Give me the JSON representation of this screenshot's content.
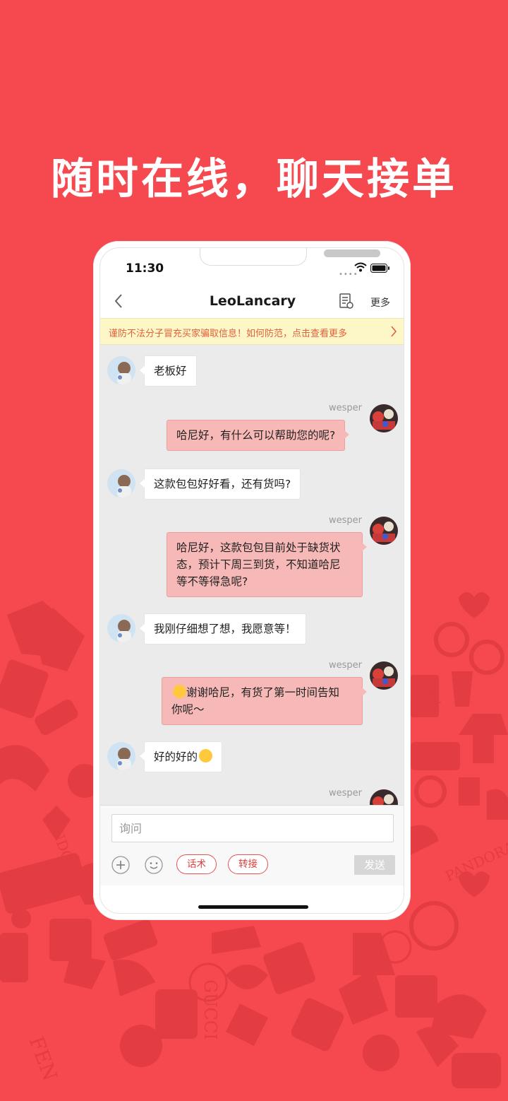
{
  "headline": "随时在线，聊天接单",
  "status_bar": {
    "time": "11:30"
  },
  "navbar": {
    "title": "LeoLancary",
    "more": "更多"
  },
  "warning": {
    "text": "谨防不法分子冒充买家骗取信息！如何防范，点击查看更多"
  },
  "messages": [
    {
      "side": "in",
      "text": "老板好"
    },
    {
      "side": "out",
      "sender": "wesper",
      "text": "哈尼好，有什么可以帮助您的呢?"
    },
    {
      "side": "in",
      "text": "这款包包好好看，还有货吗?"
    },
    {
      "side": "out",
      "sender": "wesper",
      "lines": [
        "哈尼好，这款包包目前处于缺货状",
        "态，预计下周三到货，不知道哈尼",
        "等不等得急呢?"
      ]
    },
    {
      "side": "in",
      "text": "我刚仔细想了想，我愿意等！"
    },
    {
      "side": "out",
      "sender": "wesper",
      "lines": [
        "谢谢哈尼，有货了第一时间告知",
        "你呢～"
      ]
    },
    {
      "side": "in",
      "text": "好的好的"
    },
    {
      "side": "out",
      "sender": "wesper"
    }
  ],
  "composer": {
    "placeholder": "询问",
    "script_label": "话术",
    "transfer_label": "转接",
    "send_label": "发送"
  },
  "colors": {
    "brand_red": "#f5484f",
    "bubble_out": "#f7b9b8",
    "warning_bg": "#fdf7c8",
    "warning_text": "#e2603a"
  },
  "icons": [
    "back-icon",
    "record-icon",
    "warning-arrow-icon",
    "plus-icon",
    "emoji-face-icon",
    "wifi-icon",
    "battery-icon"
  ]
}
